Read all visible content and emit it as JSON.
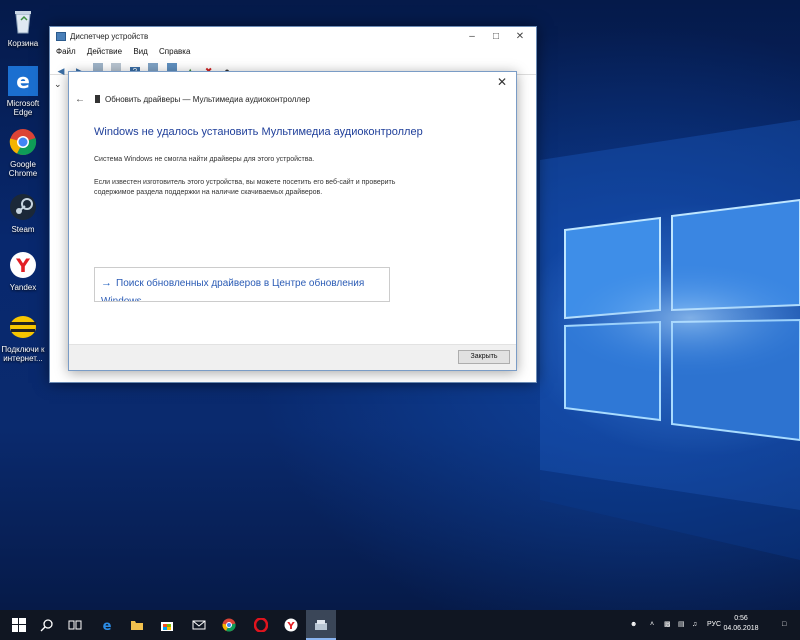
{
  "desktop": {
    "icons": [
      {
        "label": "Корзина",
        "icon": "recycle-bin-icon"
      },
      {
        "label": "Microsoft Edge",
        "icon": "edge-icon"
      },
      {
        "label": "Google Chrome",
        "icon": "chrome-icon"
      },
      {
        "label": "Steam",
        "icon": "steam-icon"
      },
      {
        "label": "Yandex",
        "icon": "yandex-icon"
      },
      {
        "label": "Подключи к интернет...",
        "icon": "beeline-icon"
      }
    ]
  },
  "device_manager": {
    "title": "Диспетчер устройств",
    "menu": [
      "Файл",
      "Действие",
      "Вид",
      "Справка"
    ]
  },
  "dialog": {
    "header": "Обновить драйверы — Мультимедиа аудиоконтроллер",
    "heading": "Windows не удалось установить Мультимедиа аудиоконтроллер",
    "paragraph1": "Система Windows не смогла найти драйверы для этого устройства.",
    "paragraph2": "Если известен изготовитель этого устройства, вы можете посетить его веб-сайт и проверить содержимое раздела поддержки на наличие скачиваемых драйверов.",
    "option_label": "Поиск обновленных драйверов в Центре обновления Windows",
    "close_button": "Закрыть"
  },
  "taskbar": {
    "language": "РУС",
    "time": "0:56",
    "date": "04.06.2018"
  },
  "colors": {
    "accent": "#1f5fbf",
    "heading": "#1f3f9a",
    "taskbar": "#101622"
  }
}
